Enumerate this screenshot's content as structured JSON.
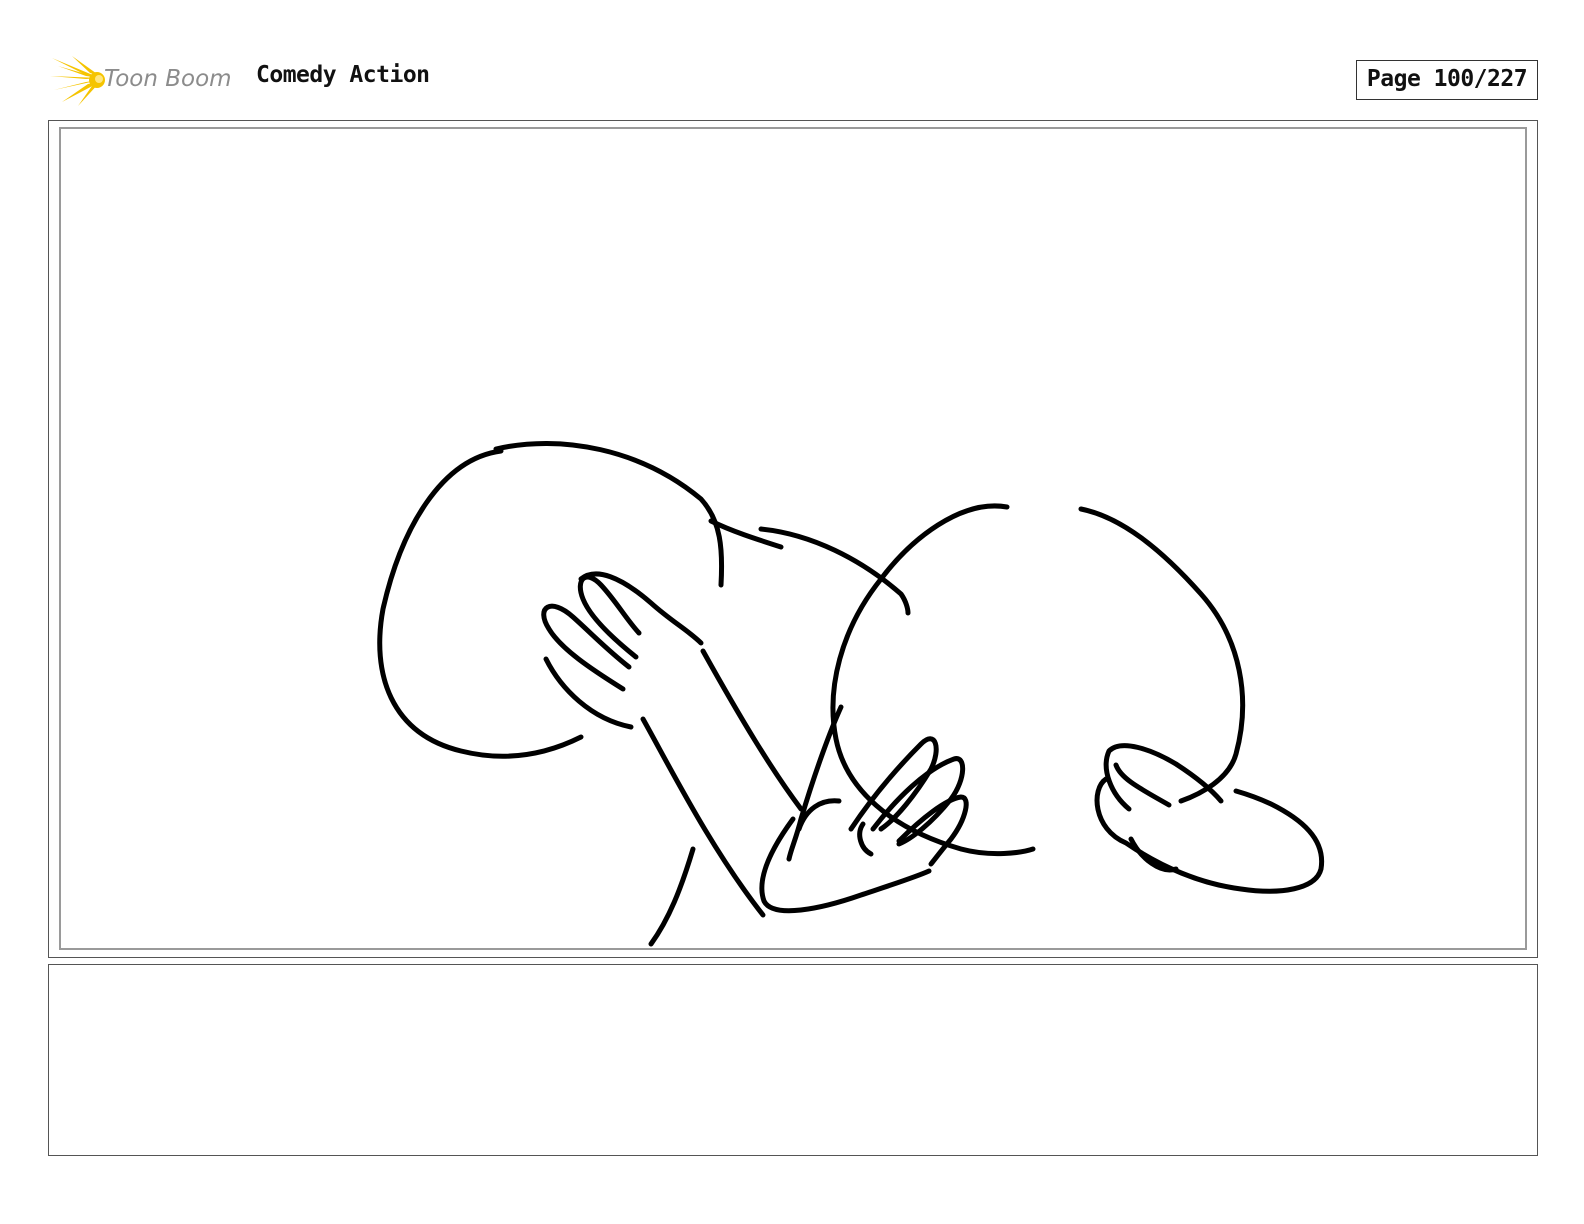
{
  "header": {
    "logo_text": "Toon Boom",
    "project_title": "Comedy Action",
    "page_number": "Page 100/227"
  },
  "notes": {
    "text": ""
  },
  "colors": {
    "logo_yellow": "#f5c400",
    "logo_text": "#8c8c8c",
    "ink": "#000000",
    "frame_border": "#9a9a9a"
  }
}
